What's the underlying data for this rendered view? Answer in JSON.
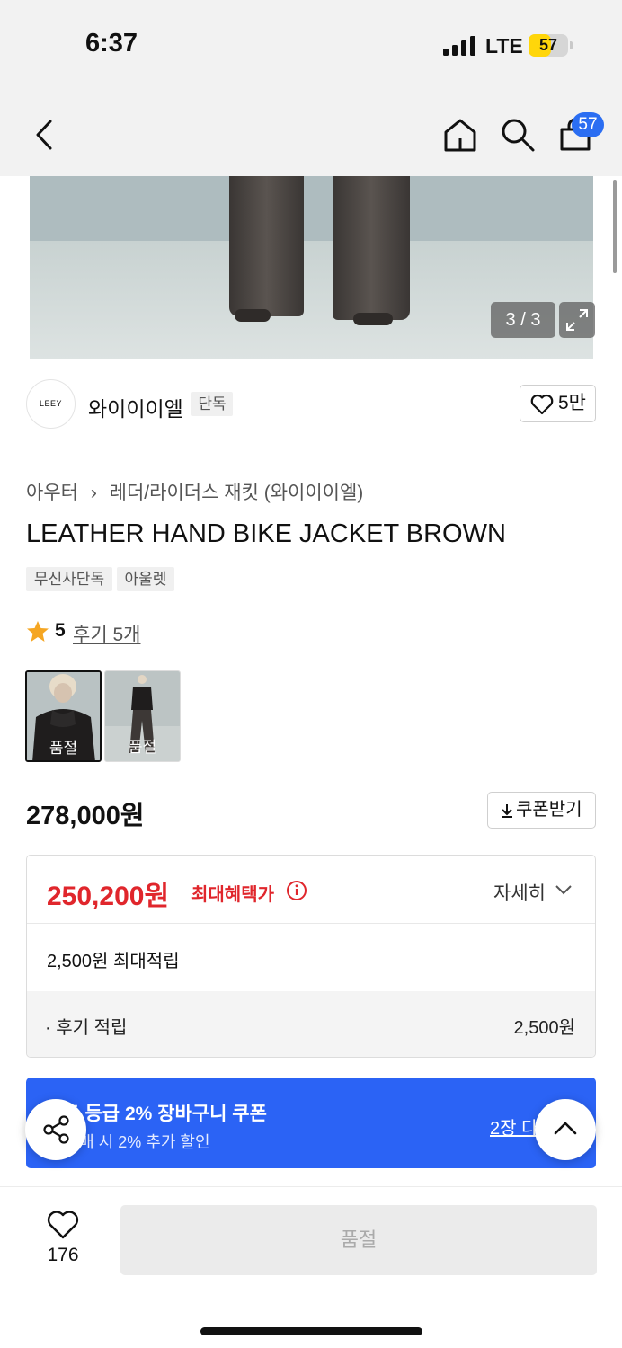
{
  "status_bar": {
    "time": "6:37",
    "network": "LTE",
    "battery_level": "57",
    "battery_color": "#ffd60a"
  },
  "nav": {
    "back_icon": "chevron-left-icon",
    "home_icon": "home-icon",
    "search_icon": "search-icon",
    "cart_icon": "shopping-bag-icon",
    "cart_count": "57",
    "badge_color": "#2b6ef2"
  },
  "gallery": {
    "counter": "3 / 3",
    "expand_icon": "expand-icon"
  },
  "brand": {
    "logo_text": "LEEY",
    "name": "와이이이엘",
    "exclusive_tag": "단독",
    "like_count": "5만"
  },
  "product": {
    "breadcrumb": [
      "아우터",
      "레더/라이더스 재킷 (와이이이엘)"
    ],
    "title": "LEATHER HAND BIKE JACKET BROWN",
    "tags": [
      "무신사단독",
      "아울렛"
    ],
    "rating": "5",
    "review_link": "후기 5개",
    "options": [
      {
        "status": "품절",
        "selected": true
      },
      {
        "status": "품절",
        "selected": false
      }
    ],
    "price": "278,000원",
    "coupon_button": "쿠폰받기"
  },
  "benefit": {
    "sale_price": "250,200원",
    "sale_label": "최대혜택가",
    "detail_toggle": "자세히",
    "points": "2,500원 최대적립",
    "review_points_label": "· 후기 적립",
    "review_points_value": "2,500원",
    "accent_color": "#e0262c"
  },
  "coupon_banner": {
    "title": "골드 등급 2% 장바구니 쿠폰",
    "subtitle": "상 구매 시 2% 추가 할인",
    "link": "2장 다",
    "color": "#2b63f5"
  },
  "floating": {
    "share_icon": "share-icon",
    "scroll_top_icon": "chevron-up-icon"
  },
  "bottom_bar": {
    "wish_icon": "heart-icon",
    "wish_count": "176",
    "purchase_button": "품절"
  }
}
